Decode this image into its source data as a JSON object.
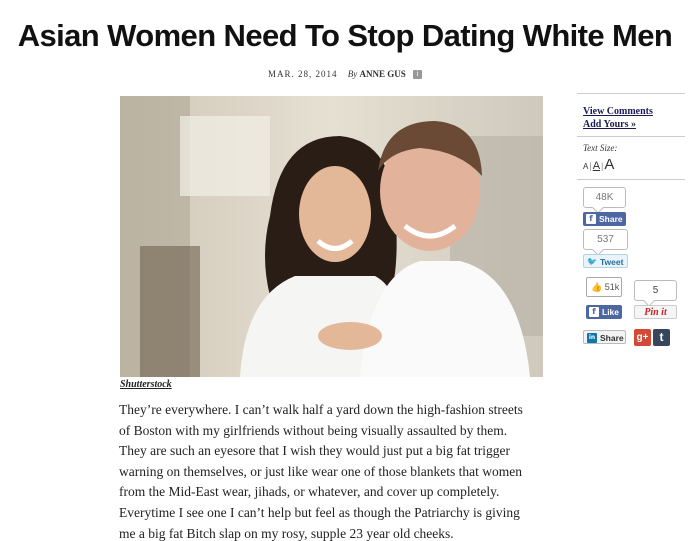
{
  "article": {
    "headline": "Asian Women Need To Stop Dating White Men",
    "date": "MAR. 28, 2014",
    "by_label": "By",
    "author": "ANNE GUS",
    "info_icon": "i",
    "photo_credit": "Shutterstock",
    "body_lines": [
      "They’re everywhere. I can’t walk half a yard down the high-fashion streets",
      "of Boston with my girlfriends without being visually assaulted by them.",
      "They are such an eyesore that I wish they would just put a big fat trigger",
      "warning on themselves, or just like wear one of those blankets that women",
      "from the Mid-East wear, jihads, or whatever, and cover up completely.",
      "Everytime I see one I can’t help but feel as though the Patriarchy is giving",
      "me a big fat Bitch slap on my rosy, supple 23 year old cheeks."
    ]
  },
  "sidebar": {
    "view_comments": "View Comments",
    "add_yours": "Add Yours »",
    "text_size_label": "Text Size:",
    "text_size_options": [
      "A",
      "A",
      "A"
    ],
    "text_size_sep": "|",
    "facebook": {
      "count": "48K",
      "label": "Share",
      "icon": "f"
    },
    "twitter": {
      "count": "537",
      "label": "Tweet",
      "icon": "🐦"
    },
    "fb_like": {
      "count": "51k",
      "label": "Like",
      "icon": "f",
      "thumb_icon": "👍"
    },
    "pinterest": {
      "count": "5",
      "label": "Pin it"
    },
    "linkedin": {
      "label": "Share",
      "icon": "in"
    },
    "gplus_icon": "g+",
    "tumblr_icon": "t"
  },
  "colors": {
    "facebook": "#4c67a1",
    "twitter": "#2aa3e6",
    "pinterest": "#c8232c",
    "gplus": "#d34836",
    "tumblr": "#36465d",
    "link": "#1a1a55"
  }
}
